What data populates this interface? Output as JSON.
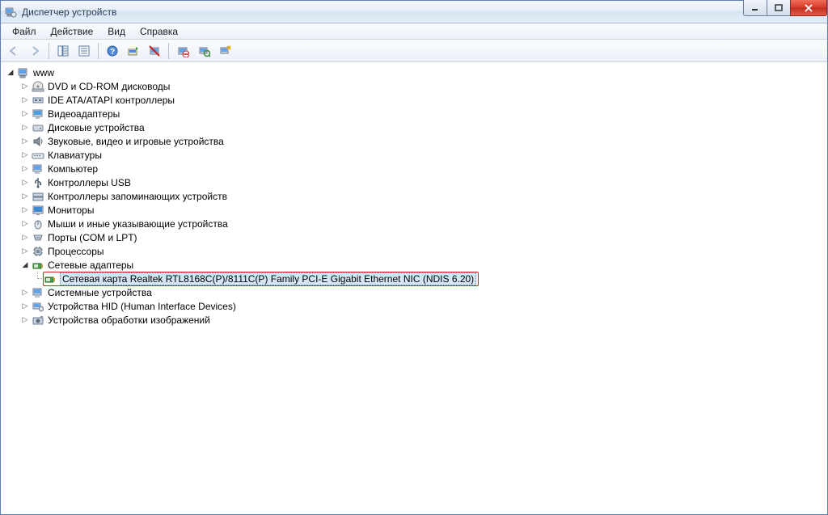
{
  "window": {
    "title": "Диспетчер устройств"
  },
  "menu": {
    "file": "Файл",
    "action": "Действие",
    "view": "Вид",
    "help": "Справка"
  },
  "tree": {
    "root": "www",
    "items": {
      "dvd": "DVD и CD-ROM дисководы",
      "ide": "IDE ATA/ATAPI контроллеры",
      "video": "Видеоадаптеры",
      "disk": "Дисковые устройства",
      "sound": "Звуковые, видео и игровые устройства",
      "keyboard": "Клавиатуры",
      "computer": "Компьютер",
      "usb": "Контроллеры USB",
      "storage": "Контроллеры запоминающих устройств",
      "monitor": "Мониторы",
      "mouse": "Мыши и иные указывающие устройства",
      "ports": "Порты (COM и LPT)",
      "cpu": "Процессоры",
      "network": "Сетевые адаптеры",
      "nic": "Сетевая карта Realtek RTL8168C(P)/8111C(P) Family PCI-E Gigabit Ethernet NIC (NDIS 6.20)",
      "system": "Системные устройства",
      "hid": "Устройства HID (Human Interface Devices)",
      "imaging": "Устройства обработки изображений"
    }
  }
}
